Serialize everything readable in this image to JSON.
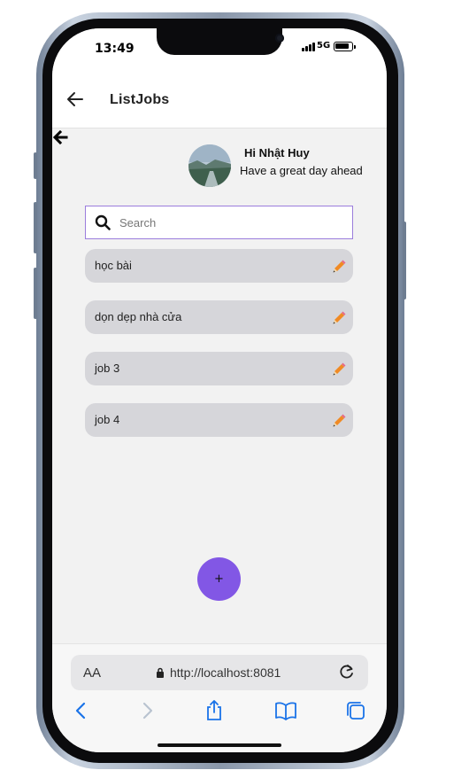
{
  "status_bar": {
    "time": "13:49",
    "network": "5G"
  },
  "app_bar": {
    "title": "ListJobs"
  },
  "header": {
    "greeting": "Hi Nhật Huy",
    "subtitle": "Have a great day ahead"
  },
  "search": {
    "placeholder": "Search",
    "value": ""
  },
  "jobs": [
    {
      "label": "học bài"
    },
    {
      "label": "dọn dẹp nhà cửa"
    },
    {
      "label": "job 3"
    },
    {
      "label": "job 4"
    }
  ],
  "fab": {
    "label": "+"
  },
  "browser": {
    "text_size_label": "AA",
    "url": "http://localhost:8081"
  },
  "colors": {
    "accent": "#8257e5",
    "search_border": "#9b7ddc",
    "job_bg": "#d6d6da",
    "ios_blue": "#1a73e8"
  },
  "icons": [
    "back-arrow-icon",
    "search-icon",
    "pencil-icon",
    "lock-icon",
    "reload-icon",
    "share-icon",
    "book-icon",
    "tabs-icon"
  ]
}
